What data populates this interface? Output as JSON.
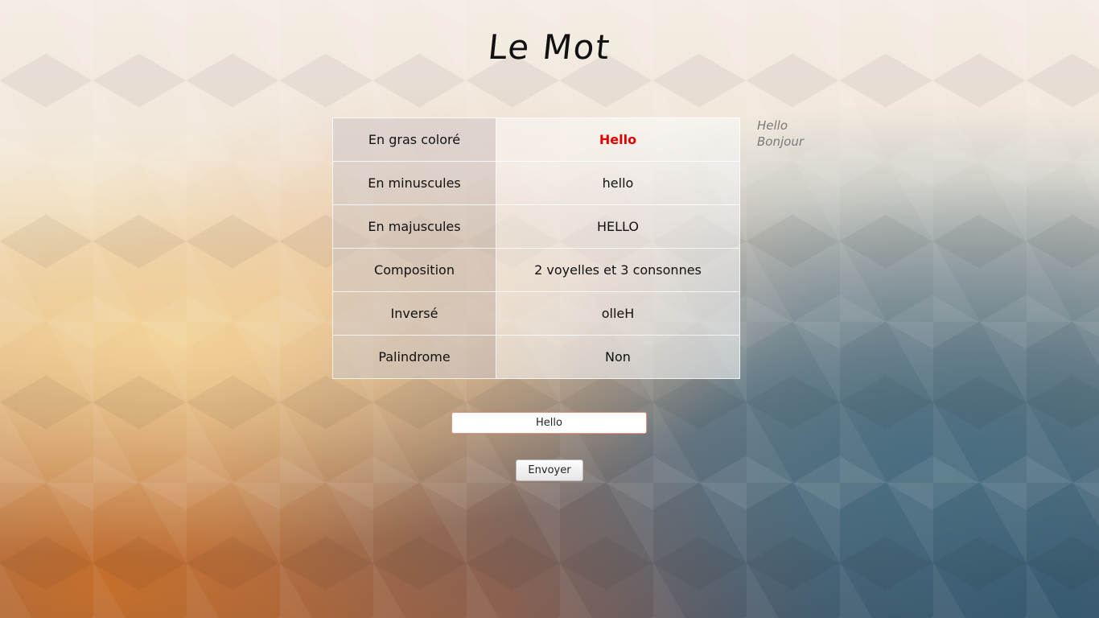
{
  "page": {
    "title": "Le Mot"
  },
  "table": {
    "rows": [
      {
        "label": "En gras coloré",
        "value": "Hello"
      },
      {
        "label": "En minuscules",
        "value": "hello"
      },
      {
        "label": "En majuscules",
        "value": "HELLO"
      },
      {
        "label": "Composition",
        "value": "2 voyelles et 3 consonnes"
      },
      {
        "label": "Inversé",
        "value": "olleH"
      },
      {
        "label": "Palindrome",
        "value": "Non"
      }
    ]
  },
  "history": {
    "items": [
      "Hello",
      "Bonjour"
    ]
  },
  "form": {
    "input_value": "Hello",
    "submit_label": "Envoyer"
  },
  "colors": {
    "highlight": "#e00000"
  }
}
